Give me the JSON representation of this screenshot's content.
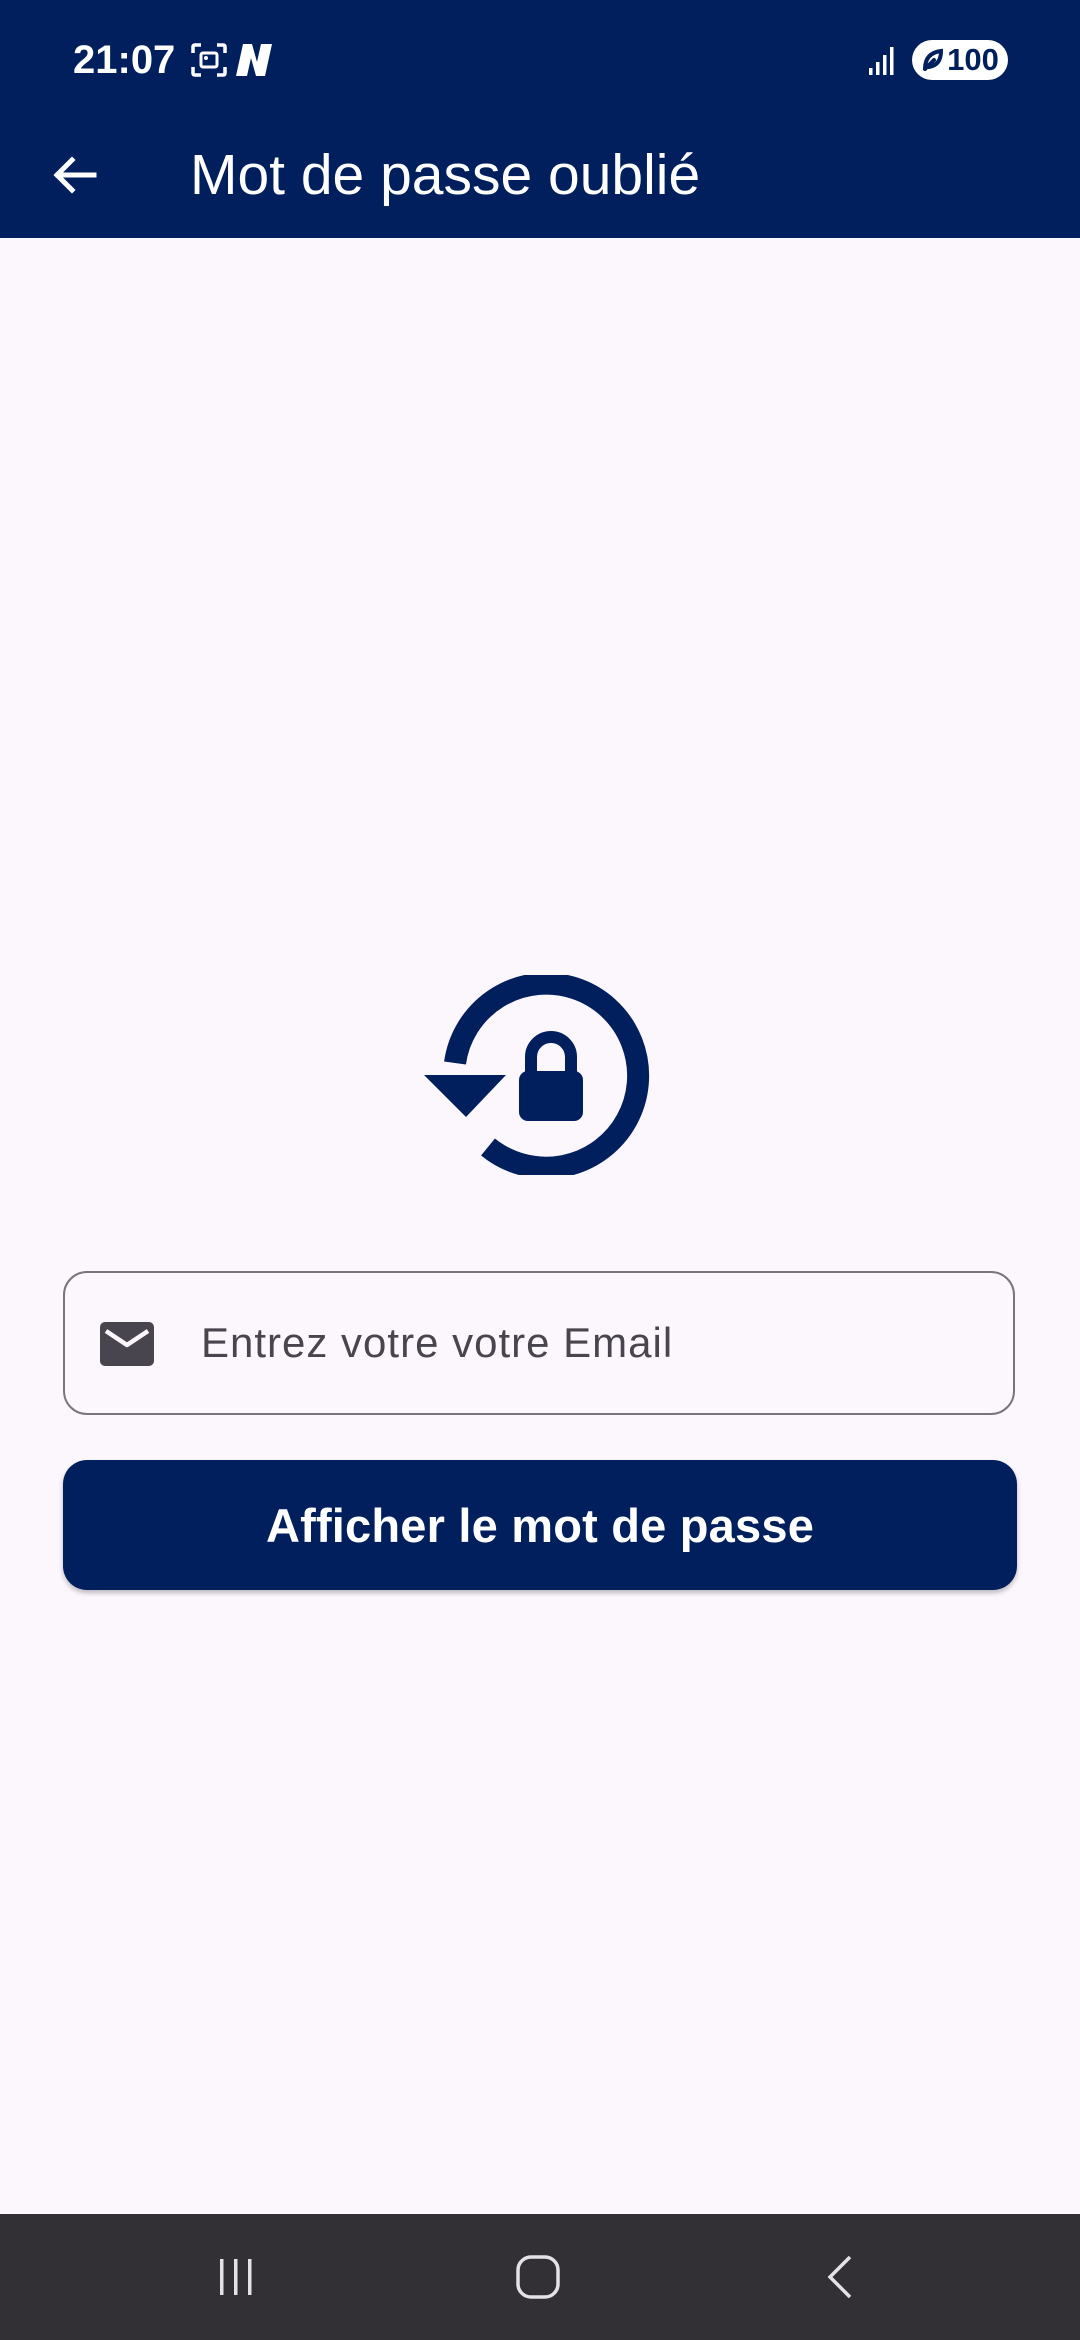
{
  "status_bar": {
    "time": "21:07",
    "battery_level": "100",
    "icons": [
      "screenshot-icon",
      "notification-n-icon",
      "signal-icon",
      "battery-saver-icon"
    ]
  },
  "app_bar": {
    "back_icon": "arrow-back-icon",
    "title": "Mot de passe oublié"
  },
  "content": {
    "graphic_icon": "lock-reset-icon",
    "email_field": {
      "icon": "mail-icon",
      "placeholder": "Entrez votre votre Email",
      "value": ""
    },
    "submit_button_label": "Afficher le mot de passe"
  },
  "system_nav": {
    "recents_icon": "recents-icon",
    "home_icon": "home-icon",
    "back_icon": "system-back-icon"
  },
  "colors": {
    "primary": "#001f5c",
    "background": "#fcf7fd",
    "field_border": "#79747e",
    "field_text": "#49454f",
    "nav_bar": "#322f35"
  }
}
